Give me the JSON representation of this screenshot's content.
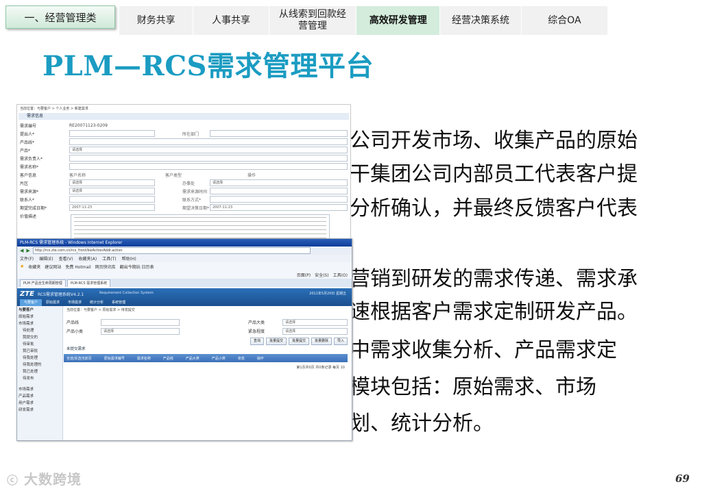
{
  "section_tag": "一、经营管理类",
  "nav_tabs": [
    {
      "label": "财务共享",
      "active": false
    },
    {
      "label": "人事共享",
      "active": false
    },
    {
      "label": "从线索到回款经营管理",
      "active": false
    },
    {
      "label": "高效研发管理",
      "active": true
    },
    {
      "label": "经营决策系统",
      "active": false
    },
    {
      "label": "综合OA",
      "active": false
    }
  ],
  "title": "PLM—RCS需求管理平台",
  "body_lines": [
    "公司开发市场、收集产品的原始",
    "干集团公司内部员工代表客户提",
    "分析确认，并最终反馈客户代表",
    "营销到研发的需求传递、需求承",
    "速根据客户需求定制研发产品。",
    "中需求收集分析、产品需求定",
    "模块包括：原始需求、市场",
    "划、统计分析。"
  ],
  "back_window": {
    "breadcrumb": "当前位置：与要客户 > 个人业务 > 新建需求",
    "section": "需求信息",
    "request_no": "RE20071123-0209",
    "date_1": "2007-11-23",
    "date_2": "2007-11-23",
    "select_placeholder": "请选择",
    "labels": [
      "需求编号",
      "提出人*",
      "产品线*",
      "产品*",
      "需求负责人*",
      "需求名称*",
      "客户信息",
      "片区",
      "需求来源*",
      "联系人*",
      "期望完成日期*",
      "价值描述"
    ],
    "extra_labels": [
      "所在部门",
      "客户名称",
      "客户类型",
      "操作",
      "办事处",
      "需求来源时间",
      "联系方式*",
      "期望决策日期*"
    ]
  },
  "front_window": {
    "titlebar": "PLM-RCS 需求管理系统 - Windows Internet Explorer",
    "address": "http://rcs.zte.com.cn/rcs_front/bizActionAddr.action",
    "menu": [
      "文件(F)",
      "编辑(E)",
      "查看(V)",
      "收藏夹(A)",
      "工具(T)",
      "帮助(H)"
    ],
    "favorites": [
      "收藏夹",
      "建议网站",
      "免费 Hotmail",
      "网页快讯库",
      "翻出今期玩 日历表"
    ],
    "toolbar_right": [
      "页面(P)",
      "安全(S)",
      "工具(O)"
    ],
    "tabs": [
      "PLM 产品全生命周期管理",
      "PLM-RCS 需求管理系统"
    ],
    "logo": "ZTE",
    "app_name": "RCS需求管理系统V4.2.1",
    "app_subtitle": "Requirement Collection System",
    "app_nav": [
      "与要客户",
      "原始需求",
      "市场需求",
      "统计分析",
      "系统管理"
    ],
    "app_nav_active": 0,
    "app_datetime": "2011年5月20日 星期五",
    "sidebar": [
      "与要客户",
      "原始需求",
      "市场需求",
      "待处理",
      "我提交的",
      "待审批",
      "我已审批",
      "待我处理",
      "待我处理的",
      "我已处理",
      "待发布",
      "市场需求",
      "产品需求",
      "用户需求",
      "研发需求"
    ],
    "breadcrumb": "当前位置：与要客户 > 原始需求 > 待发提交",
    "fields": [
      "产品线",
      "产品大类",
      "产品小类",
      "紧急程度"
    ],
    "select_placeholder": "请选择",
    "buttons": [
      "查询",
      "批量提交",
      "批量提交",
      "批量删除",
      "导入"
    ],
    "section": "未提交需求",
    "grid_columns": [
      "全选/反选当前页",
      "原始需求编号",
      "需求名称",
      "产品线",
      "产品大类",
      "产品小类",
      "状态",
      "操作"
    ],
    "pager": "第1页共0页 共0条记录 每页 10"
  },
  "watermark": "大数跨境",
  "page_number": "69"
}
